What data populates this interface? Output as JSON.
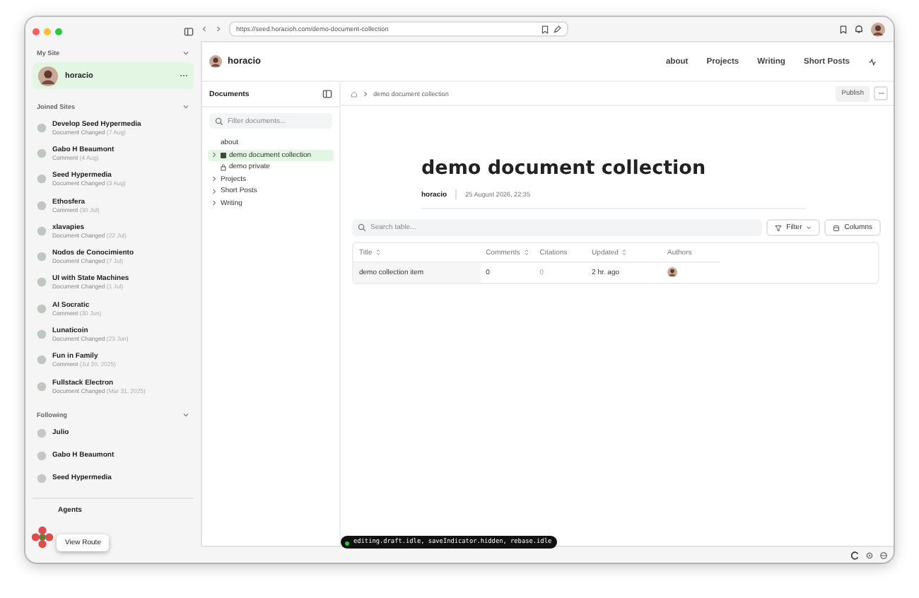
{
  "browser": {
    "url": "https://seed.horacioh.com/demo-document-collection"
  },
  "sidebar": {
    "my_site_label": "My Site",
    "site": {
      "name": "horacio"
    },
    "joined_label": "Joined Sites",
    "joined": [
      {
        "name": "Develop Seed Hypermedia",
        "activity": "Document Changed",
        "date": "(7 Aug)"
      },
      {
        "name": "Gabo H Beaumont",
        "activity": "Comment",
        "date": "(4 Aug)"
      },
      {
        "name": "Seed Hypermedia",
        "activity": "Document Changed",
        "date": "(3 Aug)"
      },
      {
        "name": "Ethosfera",
        "activity": "Comment",
        "date": "(30 Jul)"
      },
      {
        "name": "xlavapies",
        "activity": "Document Changed",
        "date": "(22 Jul)"
      },
      {
        "name": "Nodos de Conocimiento",
        "activity": "Document Changed",
        "date": "(7 Jul)"
      },
      {
        "name": "UI with State Machines",
        "activity": "Document Changed",
        "date": "(1 Jul)"
      },
      {
        "name": "AI Socratic",
        "activity": "Comment",
        "date": "(30 Jun)"
      },
      {
        "name": "Lunaticoin",
        "activity": "Document Changed",
        "date": "(23 Jun)"
      },
      {
        "name": "Fun in Family",
        "activity": "Comment",
        "date": "(Jul 20, 2025)"
      },
      {
        "name": "Fullstack Electron",
        "activity": "Document Changed",
        "date": "(Mar 31, 2025)"
      }
    ],
    "following_label": "Following",
    "following": [
      "Julio",
      "Gabo H Beaumont",
      "Seed Hypermedia"
    ],
    "agents": "Agents",
    "tooltip": "View Route"
  },
  "header": {
    "site_name": "horacio",
    "nav": [
      "about",
      "Projects",
      "Writing",
      "Short Posts"
    ]
  },
  "documents": {
    "title": "Documents",
    "placeholder": "Filter documents...",
    "tree": [
      {
        "label": "about",
        "kind": "page",
        "selected": false
      },
      {
        "label": "demo document collection",
        "kind": "collection",
        "selected": true
      },
      {
        "label": "demo private",
        "kind": "private",
        "selected": false
      },
      {
        "label": "Projects",
        "kind": "folder",
        "selected": false
      },
      {
        "label": "Short Posts",
        "kind": "folder",
        "selected": false
      },
      {
        "label": "Writing",
        "kind": "folder",
        "selected": false
      }
    ]
  },
  "breadcrumb": "demo document collection",
  "publish": "Publish",
  "document": {
    "title": "demo document collection",
    "author": "horacio",
    "date": "25 August 2026, 22:35"
  },
  "table": {
    "placeholder": "Search table...",
    "filter": "Filter",
    "columns_button": "Columns",
    "columns": [
      {
        "label": "Title",
        "sortable": true
      },
      {
        "label": "Comments",
        "sortable": true
      },
      {
        "label": "Citations",
        "sortable": false
      },
      {
        "label": "Updated",
        "sortable": true
      },
      {
        "label": "Authors",
        "sortable": false
      }
    ],
    "rows": [
      {
        "title": "demo collection item",
        "comments": "0",
        "citations": "0",
        "updated": "2 hr. ago"
      }
    ]
  },
  "status": "editing.draft.idle, saveIndicator.hidden, rebase.idle"
}
